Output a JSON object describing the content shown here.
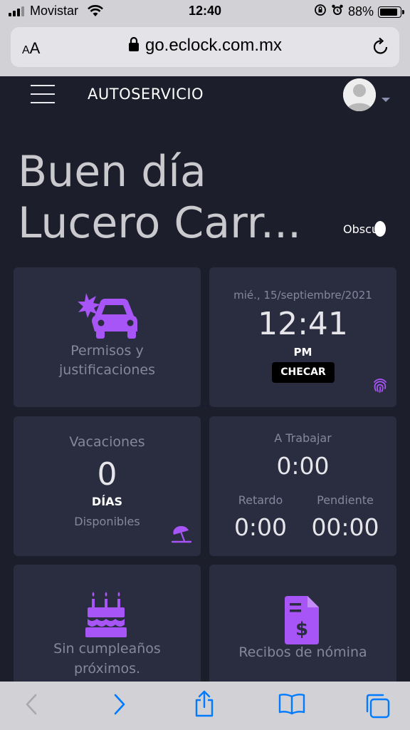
{
  "status_bar": {
    "carrier": "Movistar",
    "time": "12:40",
    "battery": "88%",
    "battery_level": 0.88
  },
  "browser": {
    "text_size_label_small": "A",
    "text_size_label_big": "A",
    "url": "go.eclock.com.mx"
  },
  "header": {
    "title": "AUTOSERVICIO"
  },
  "greeting": {
    "line1": "Buen día",
    "line2": "Lucero Carr..."
  },
  "theme_toggle": {
    "label": "Obscu"
  },
  "cards": {
    "permisos": {
      "label_line1": "Permisos y",
      "label_line2": "justificaciones"
    },
    "clock": {
      "date": "mié., 15/septiembre/2021",
      "time": "12:41",
      "ampm": "PM",
      "button": "CHECAR"
    },
    "vacaciones": {
      "title": "Vacaciones",
      "count": "0",
      "unit": "DÍAS",
      "subtitle": "Disponibles"
    },
    "trabajo": {
      "title": "A Trabajar",
      "time": "0:00",
      "retardo_label": "Retardo",
      "retardo_value": "0:00",
      "pendiente_label": "Pendiente",
      "pendiente_value": "00:00"
    },
    "cumple": {
      "line1": "Sin cumpleaños",
      "line2": "próximos."
    },
    "recibos": {
      "label": "Recibos de nómina"
    }
  },
  "colors": {
    "page_bg": "#1d1e2c",
    "card_bg": "#2a2c40",
    "accent_purple": "#a855f7",
    "ios_blue": "#007aff"
  },
  "icons": {
    "status": [
      "signal-icon",
      "wifi-icon",
      "orientation-lock-icon",
      "alarm-icon",
      "battery-icon"
    ],
    "browser": [
      "lock-icon",
      "reload-icon"
    ],
    "cards": [
      "car-crash-icon",
      "fingerprint-icon",
      "beach-umbrella-icon",
      "birthday-cake-icon",
      "receipt-dollar-icon"
    ],
    "toolbar": [
      "back-icon",
      "forward-icon",
      "share-icon",
      "bookmarks-icon",
      "tabs-icon"
    ]
  }
}
